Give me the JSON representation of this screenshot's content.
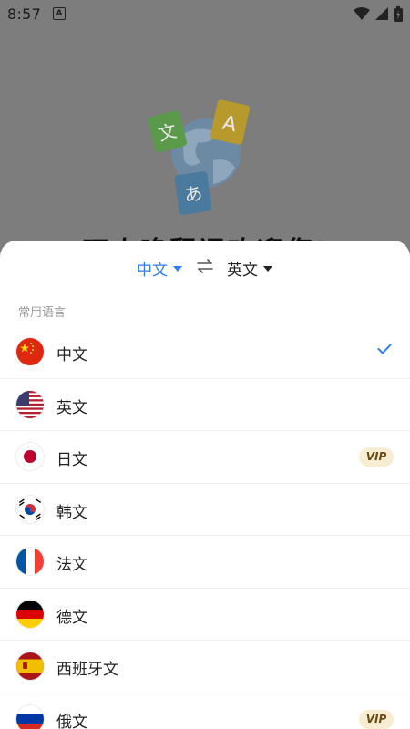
{
  "status": {
    "time": "8:57",
    "notification_icon": "A"
  },
  "hero": {
    "welcome": "叮小咚翻译欢迎您!",
    "art_glyphs": [
      "文",
      "A",
      "あ"
    ]
  },
  "switcher": {
    "source": "中文",
    "target": "英文",
    "source_color": "#2f7df6"
  },
  "section_title": "常用语言",
  "languages": [
    {
      "label": "中文",
      "flag": "china-flag-icon",
      "selected": true
    },
    {
      "label": "英文",
      "flag": "usa-flag-icon"
    },
    {
      "label": "日文",
      "flag": "japan-flag-icon",
      "badge": "VIP"
    },
    {
      "label": "韩文",
      "flag": "korea-flag-icon"
    },
    {
      "label": "法文",
      "flag": "france-flag-icon"
    },
    {
      "label": "德文",
      "flag": "germany-flag-icon"
    },
    {
      "label": "西班牙文",
      "flag": "spain-flag-icon"
    },
    {
      "label": "俄文",
      "flag": "russia-flag-icon",
      "badge": "VIP"
    }
  ],
  "colors": {
    "accent": "#2f7df6",
    "vip_bg": "#f8ecd3",
    "vip_text": "#6b4a16",
    "overlay": "#7d7d7d"
  }
}
